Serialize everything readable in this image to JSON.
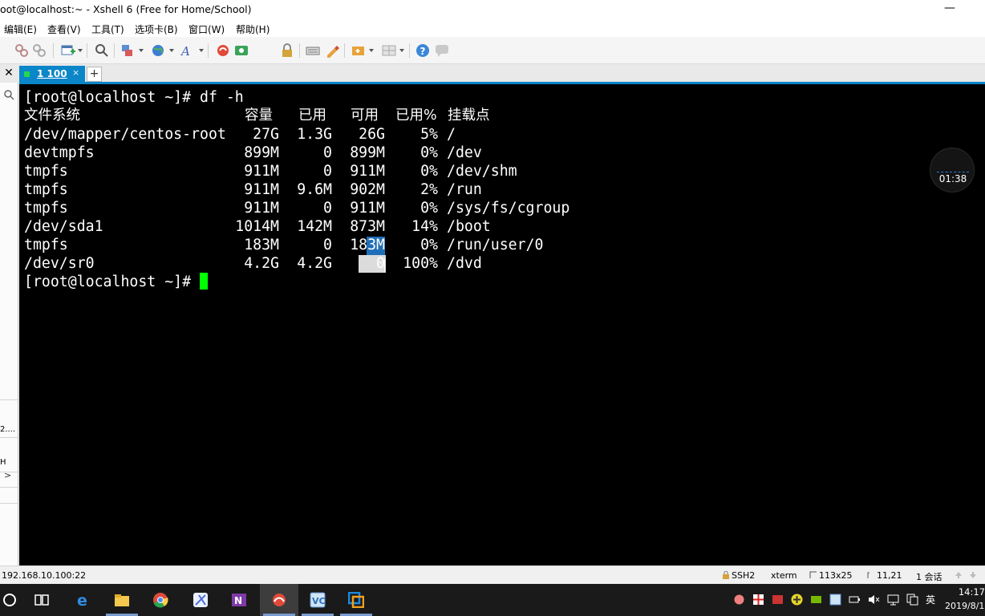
{
  "window": {
    "title": "oot@localhost:~ - Xshell 6 (Free for Home/School)",
    "minimize_glyph": "—"
  },
  "menu": [
    "编辑(E)",
    "查看(V)",
    "工具(T)",
    "选项卡(B)",
    "窗口(W)",
    "帮助(H)"
  ],
  "toolbar_icons": [
    "new-session-icon",
    "disconnect-icon",
    "reconnect-icon",
    "new-tab-icon",
    "find-icon",
    "properties-icon",
    "globe-icon",
    "font-icon",
    "xftp-icon",
    "xmanager-icon",
    "lock-icon",
    "keyboard-icon",
    "highlight-icon",
    "script-icon",
    "layout-icon",
    "help-icon",
    "chat-icon"
  ],
  "tabs": [
    {
      "label": "1 100",
      "status_color": "#23d94a"
    }
  ],
  "tab_close_glyph": "×",
  "tab_add_glyph": "+",
  "side_close_glyph": "✕",
  "sidebar": {
    "collapse_glyph": ">",
    "texts": [
      "2....",
      "H"
    ]
  },
  "terminal": {
    "prompt": "[root@localhost ~]# ",
    "command": "df -h",
    "headers": [
      "文件系统",
      "容量",
      "已用",
      "可用",
      "已用%",
      "挂载点"
    ],
    "rows": [
      {
        "fs": "/dev/mapper/centos-root",
        "size": "27G",
        "used": "1.3G",
        "avail": "26G",
        "pct": "5%",
        "mount": "/"
      },
      {
        "fs": "devtmpfs",
        "size": "899M",
        "used": "0",
        "avail": "899M",
        "pct": "0%",
        "mount": "/dev"
      },
      {
        "fs": "tmpfs",
        "size": "911M",
        "used": "0",
        "avail": "911M",
        "pct": "0%",
        "mount": "/dev/shm"
      },
      {
        "fs": "tmpfs",
        "size": "911M",
        "used": "9.6M",
        "avail": "902M",
        "pct": "2%",
        "mount": "/run"
      },
      {
        "fs": "tmpfs",
        "size": "911M",
        "used": "0",
        "avail": "911M",
        "pct": "0%",
        "mount": "/sys/fs/cgroup"
      },
      {
        "fs": "/dev/sda1",
        "size": "1014M",
        "used": "142M",
        "avail": "873M",
        "pct": "14%",
        "mount": "/boot"
      },
      {
        "fs": "tmpfs",
        "size": "183M",
        "used": "0",
        "avail": "183M",
        "pct": "0%",
        "mount": "/run/user/0"
      },
      {
        "fs": "/dev/sr0",
        "size": "4.2G",
        "used": "4.2G",
        "avail": "0",
        "pct": "100%",
        "mount": "/dvd"
      }
    ],
    "final_prompt": "[root@localhost ~]#",
    "cursor_color": "#00ff00"
  },
  "clock_widget": {
    "time": "01:38"
  },
  "statusbar": {
    "address": "192.168.10.100:22",
    "protocol": "SSH2",
    "term": "xterm",
    "size": "113x25",
    "position": "11,21",
    "sessions": "1 会话"
  },
  "taskbar": {
    "apps": [
      "start",
      "task-view",
      "edge",
      "file-explorer",
      "chrome",
      "snipaste",
      "onenote",
      "xshell",
      "vmware",
      "virtualbox"
    ],
    "active": "xshell",
    "tray_icons": [
      "app1",
      "app2",
      "app3",
      "add",
      "nvidia",
      "vmware-tray",
      "battery",
      "volume",
      "network",
      "copy"
    ],
    "ime": "英",
    "time": "14:17",
    "date": "2019/8/1"
  }
}
